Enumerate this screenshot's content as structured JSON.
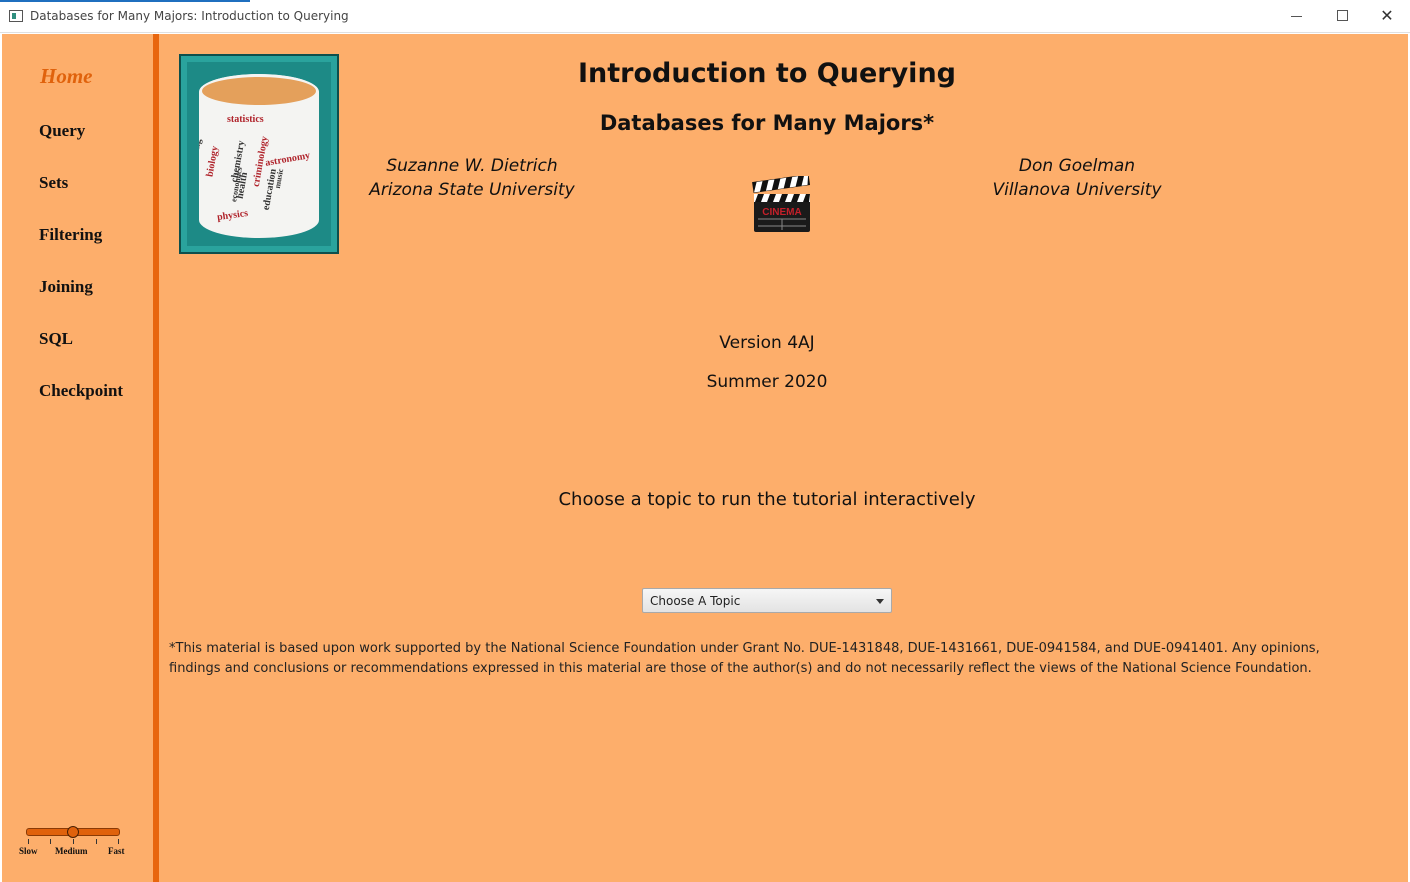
{
  "window": {
    "title": "Databases for Many Majors: Introduction to Querying",
    "minimize_glyph": "",
    "close_glyph": "✕"
  },
  "sidebar": {
    "items": [
      {
        "label": "Home",
        "active": true
      },
      {
        "label": "Query"
      },
      {
        "label": "Sets"
      },
      {
        "label": "Filtering"
      },
      {
        "label": "Joining"
      },
      {
        "label": "SQL"
      },
      {
        "label": "Checkpoint"
      }
    ]
  },
  "speed_slider": {
    "labels": [
      "Slow",
      "Medium",
      "Fast"
    ],
    "value": "Medium"
  },
  "logo": {
    "words": [
      "statistics",
      "astronomy",
      "criminology",
      "chemistry",
      "biology",
      "engineering",
      "linguistics",
      "journalism",
      "health",
      "economics",
      "education",
      "music",
      "physics"
    ]
  },
  "header": {
    "title": "Introduction to Querying",
    "subtitle": "Databases for Many Majors*"
  },
  "authors": [
    {
      "name": "Suzanne W. Dietrich",
      "affiliation": "Arizona State University"
    },
    {
      "name": "Don Goelman",
      "affiliation": "Villanova University"
    }
  ],
  "clapper_icon": {
    "text": "CINEMA"
  },
  "version": "Version 4AJ",
  "date": "Summer 2020",
  "prompt": "Choose a topic to run the tutorial interactively",
  "topic_select": {
    "value": "Choose A Topic"
  },
  "footnote": "*This material is based upon work supported by the National Science Foundation under Grant No. DUE-1431848, DUE-1431661, DUE-0941584,  and DUE-0941401. Any opinions, findings and conclusions or recommendations expressed in this material are those of the author(s) and do not necessarily reflect the views of the National Science Foundation.",
  "colors": {
    "background": "#fdae6b",
    "accent": "#e8660e",
    "home": "#e0620c",
    "logo_teal": "#1d8a86"
  }
}
